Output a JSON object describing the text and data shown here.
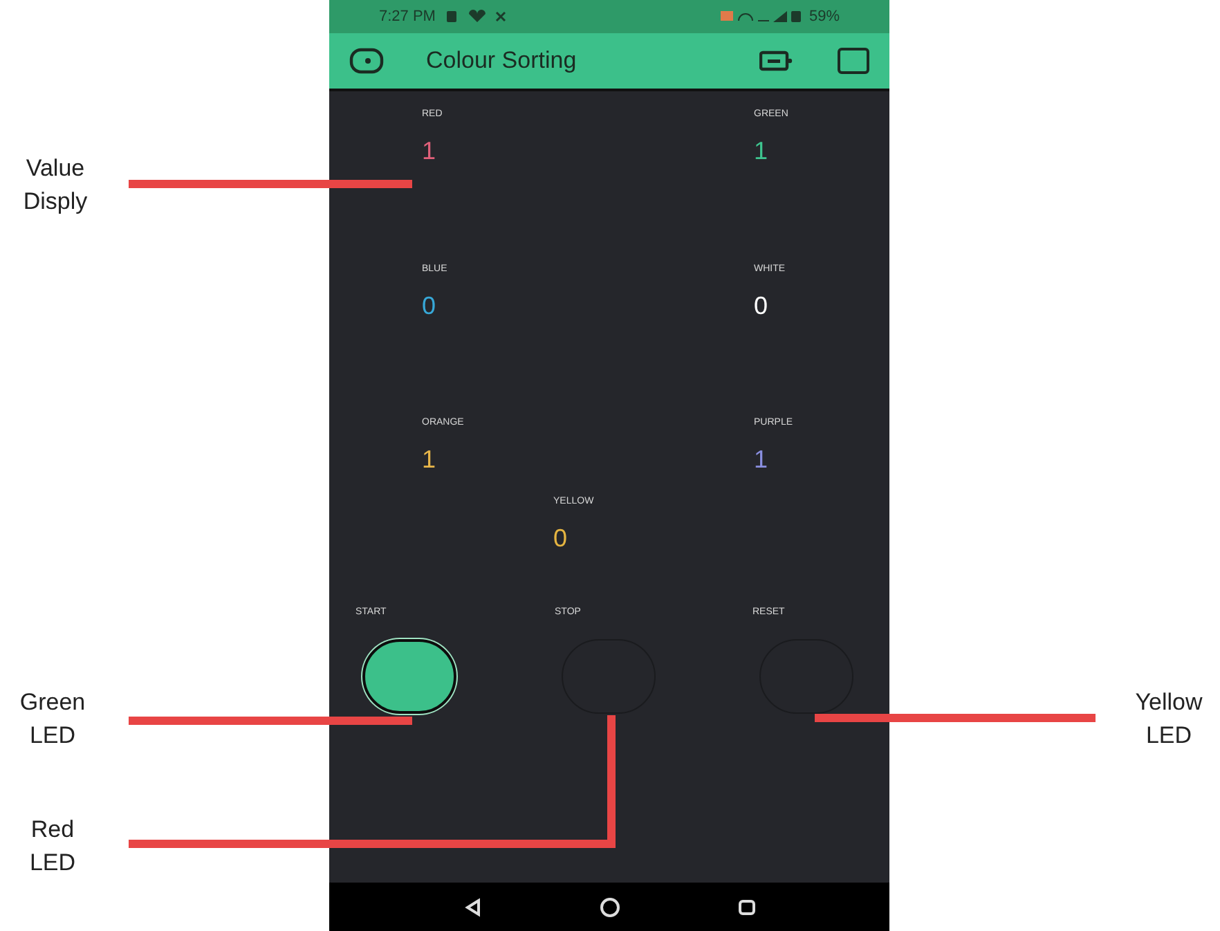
{
  "status_bar": {
    "time": "7:27 PM",
    "battery": "59%"
  },
  "app_bar": {
    "title": "Colour Sorting"
  },
  "displays": [
    {
      "label": "RED",
      "value": "1",
      "color": "#e0607a"
    },
    {
      "label": "GREEN",
      "value": "1",
      "color": "#3ec48f"
    },
    {
      "label": "BLUE",
      "value": "0",
      "color": "#37a8d8"
    },
    {
      "label": "WHITE",
      "value": "0",
      "color": "#ffffff"
    },
    {
      "label": "ORANGE",
      "value": "1",
      "color": "#e8b64a"
    },
    {
      "label": "PURPLE",
      "value": "1",
      "color": "#8a8fe0"
    },
    {
      "label": "YELLOW",
      "value": "0",
      "color": "#e5b441"
    }
  ],
  "leds": [
    {
      "label": "START",
      "on": true
    },
    {
      "label": "STOP",
      "on": false
    },
    {
      "label": "RESET",
      "on": false
    }
  ],
  "annotations": [
    {
      "text": "Value Disply"
    },
    {
      "text": "Green LED"
    },
    {
      "text": "Red LED"
    },
    {
      "text": "Yellow LED"
    }
  ]
}
